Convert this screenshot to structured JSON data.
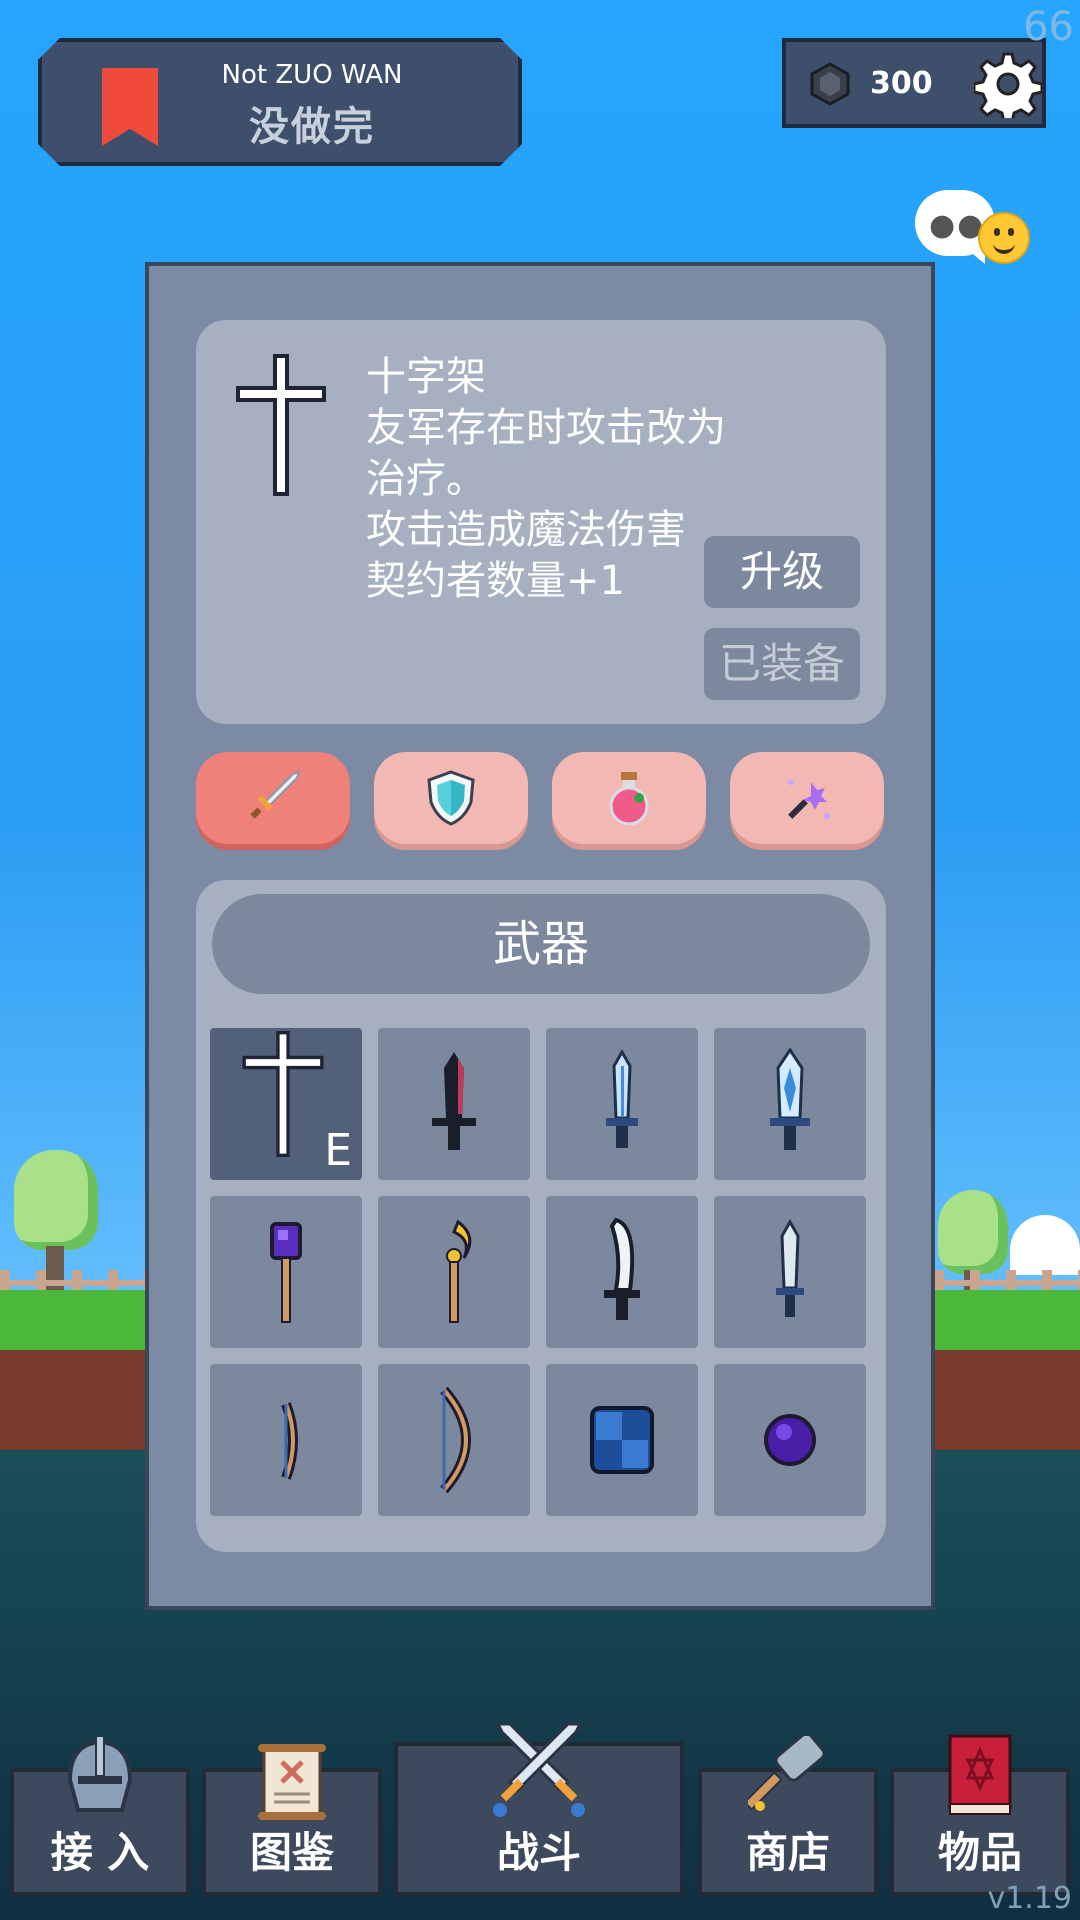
{
  "status": {
    "fps": "66",
    "version": "v1.19"
  },
  "header": {
    "title_en": "Not ZUO WAN",
    "title_cn": "没做完",
    "coins": "300"
  },
  "selected_item": {
    "name": "十字架",
    "description_lines": [
      "友军存在时攻击改为",
      "治疗。",
      "攻击造成魔法伤害",
      "契约者数量+1"
    ],
    "upgrade_label": "升级",
    "equipped_label": "已装备"
  },
  "category_tabs": [
    {
      "icon": "sword-icon",
      "active": true
    },
    {
      "icon": "shield-icon",
      "active": false
    },
    {
      "icon": "potion-icon",
      "active": false
    },
    {
      "icon": "magic-wand-icon",
      "active": false
    }
  ],
  "inventory": {
    "title": "武器",
    "equipped_mark": "E",
    "slots": [
      {
        "icon": "cross-icon",
        "selected": true,
        "equipped": true
      },
      {
        "icon": "dark-blade-icon"
      },
      {
        "icon": "ice-dagger-icon"
      },
      {
        "icon": "ice-sword-icon"
      },
      {
        "icon": "purple-staff-icon"
      },
      {
        "icon": "moon-staff-icon"
      },
      {
        "icon": "curved-sword-icon"
      },
      {
        "icon": "steel-dagger-icon"
      },
      {
        "icon": "short-bow-icon"
      },
      {
        "icon": "long-bow-icon"
      },
      {
        "icon": "blue-shield-icon"
      },
      {
        "icon": "purple-orb-icon"
      }
    ]
  },
  "bottom_nav": [
    {
      "label": "接 入",
      "icon": "helmet-icon"
    },
    {
      "label": "图鉴",
      "icon": "scroll-icon"
    },
    {
      "label": "战斗",
      "icon": "crossed-swords-icon"
    },
    {
      "label": "商店",
      "icon": "hammer-icon"
    },
    {
      "label": "物品",
      "icon": "spellbook-icon"
    }
  ],
  "colors": {
    "panel": "#7c8aa3",
    "card": "#a6b0c0",
    "tab_active": "#f0807a",
    "tab_inactive": "#f2b8b3",
    "bookmark": "#f04b3a"
  }
}
